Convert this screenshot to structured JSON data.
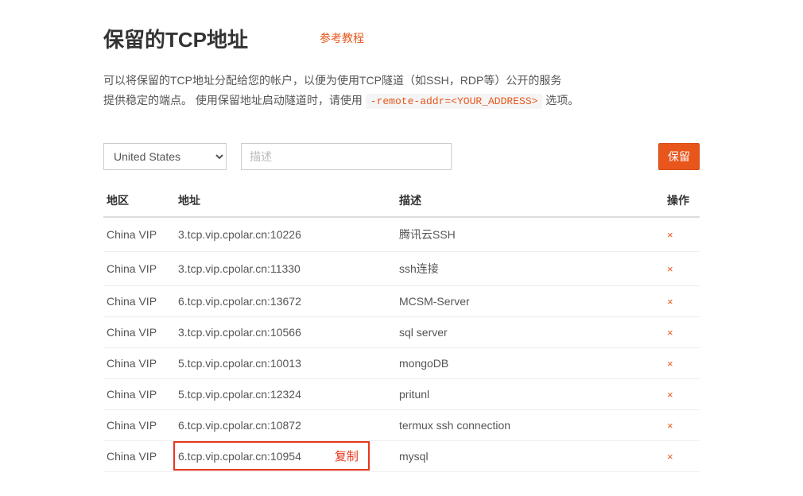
{
  "header": {
    "title": "保留的TCP地址",
    "ref_link": "参考教程"
  },
  "description": {
    "line1": "可以将保留的TCP地址分配给您的帐户，以便为使用TCP隧道（如SSH，RDP等）公开的服务",
    "line2_prefix": "提供稳定的端点。 使用保留地址启动隧道时，请使用 ",
    "code": "-remote-addr=<YOUR_ADDRESS>",
    "line2_suffix": " 选项。"
  },
  "form": {
    "region_selected": "United States",
    "desc_placeholder": "描述",
    "reserve_label": "保留"
  },
  "table": {
    "headers": {
      "region": "地区",
      "address": "地址",
      "desc": "描述",
      "op": "操作"
    },
    "rows": [
      {
        "region": "China VIP",
        "address": "3.tcp.vip.cpolar.cn:10226",
        "desc": "腾讯云SSH"
      },
      {
        "region": "China VIP",
        "address": "3.tcp.vip.cpolar.cn:11330",
        "desc": "ssh连接"
      },
      {
        "region": "China VIP",
        "address": "6.tcp.vip.cpolar.cn:13672",
        "desc": "MCSM-Server"
      },
      {
        "region": "China VIP",
        "address": "3.tcp.vip.cpolar.cn:10566",
        "desc": "sql server"
      },
      {
        "region": "China VIP",
        "address": "5.tcp.vip.cpolar.cn:10013",
        "desc": "mongoDB"
      },
      {
        "region": "China VIP",
        "address": "5.tcp.vip.cpolar.cn:12324",
        "desc": "pritunl"
      },
      {
        "region": "China VIP",
        "address": "6.tcp.vip.cpolar.cn:10872",
        "desc": "termux ssh connection"
      },
      {
        "region": "China VIP",
        "address": "6.tcp.vip.cpolar.cn:10954",
        "desc": "mysql",
        "highlight": true,
        "copy_label": "复制"
      }
    ],
    "delete_icon": "×"
  }
}
